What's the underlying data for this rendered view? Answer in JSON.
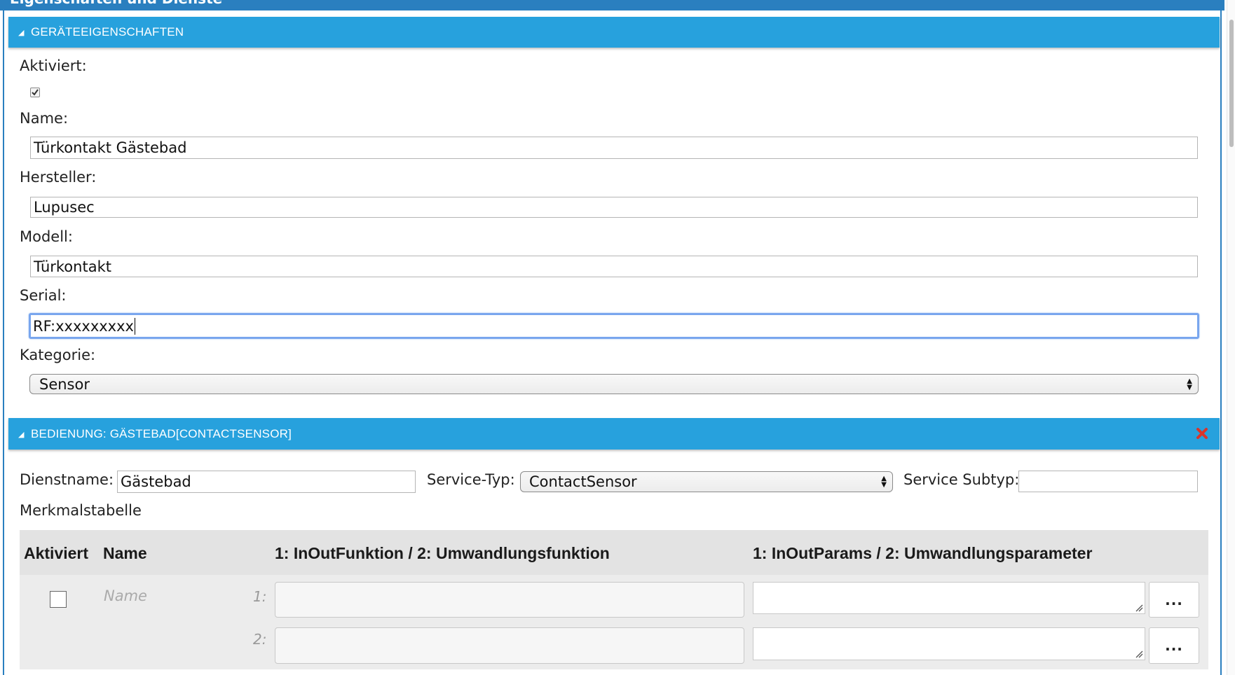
{
  "window": {
    "title": "Eigenschaften und Dienste"
  },
  "device_section": {
    "title": "GERÄTEEIGENSCHAFTEN",
    "enabled_label": "Aktiviert:",
    "enabled": true,
    "name_label": "Name:",
    "name_value": "Türkontakt Gästebad",
    "manufacturer_label": "Hersteller:",
    "manufacturer_value": "Lupusec",
    "model_label": "Modell:",
    "model_value": "Türkontakt",
    "serial_label": "Serial:",
    "serial_value": "RF:xxxxxxxxx",
    "category_label": "Kategorie:",
    "category_value": "Sensor"
  },
  "service_section": {
    "title": "BEDIENUNG: GÄSTEBAD[CONTACTSENSOR]",
    "service_name_label": "Dienstname:",
    "service_name_value": "Gästebad",
    "service_type_label": "Service-Typ:",
    "service_type_value": "ContactSensor",
    "service_subtype_label": "Service Subtyp:",
    "service_subtype_value": "",
    "table_title": "Merkmalstabelle",
    "table": {
      "headers": [
        "Aktiviert",
        "Name",
        "1: InOutFunktion / 2: Umwandlungsfunktion",
        "1: InOutParams / 2: Umwandlungsparameter"
      ],
      "row": {
        "name_placeholder": "Name",
        "num1": "1:",
        "num2": "2:",
        "more_label": "..."
      }
    }
  },
  "colors": {
    "header_bg": "#27a1dd",
    "title_bar": "#2a7fbf",
    "close_icon": "#d9342b",
    "focus_ring": "#79a6ee"
  }
}
